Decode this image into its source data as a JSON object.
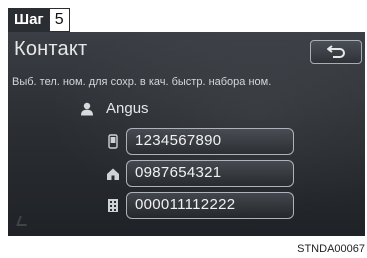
{
  "step": {
    "label": "Шаг",
    "number": "5"
  },
  "screen": {
    "title": "Контакт",
    "instruction": "Выб. тел. ном. для сохр. в кач. быстр. набора ном.",
    "contact": {
      "name": "Angus",
      "icon": "person-icon"
    },
    "numbers": [
      {
        "icon": "mobile-phone-icon",
        "value": "1234567890"
      },
      {
        "icon": "home-icon",
        "value": "0987654321"
      },
      {
        "icon": "office-building-icon",
        "value": "000011112222"
      }
    ],
    "back_icon": "back-arrow-icon"
  },
  "footer": {
    "code": "STNDA00067"
  },
  "colors": {
    "screen_bg": "#2b2e33",
    "button_border": "#aeb3ba",
    "text": "#e7e7e7"
  }
}
